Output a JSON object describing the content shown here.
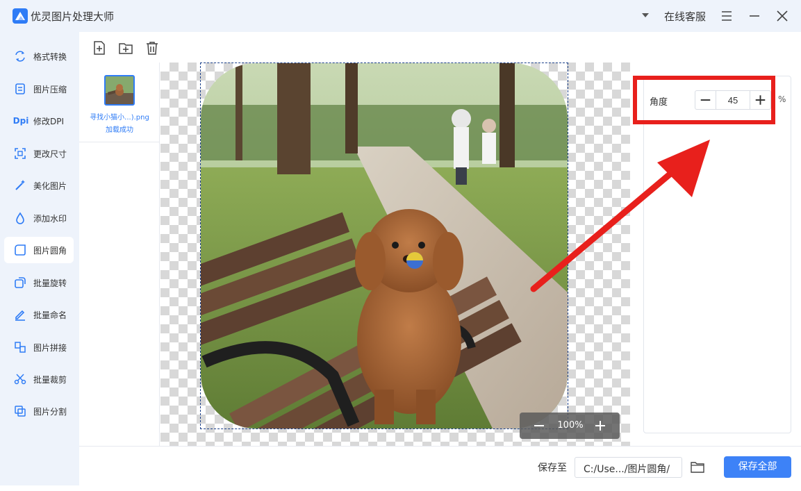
{
  "app": {
    "title": "优灵图片处理大师",
    "support_label": "在线客服"
  },
  "sidebar": {
    "items": [
      {
        "label": "格式转换",
        "icon": "format-convert-icon",
        "active": false
      },
      {
        "label": "图片压缩",
        "icon": "compress-icon",
        "active": false
      },
      {
        "label": "修改DPI",
        "icon": "dpi-icon",
        "icon_text": "Dpi",
        "active": false
      },
      {
        "label": "更改尺寸",
        "icon": "resize-icon",
        "active": false
      },
      {
        "label": "美化图片",
        "icon": "magic-wand-icon",
        "active": false
      },
      {
        "label": "添加水印",
        "icon": "watermark-icon",
        "active": false
      },
      {
        "label": "图片圆角",
        "icon": "rounded-corner-icon",
        "active": true
      },
      {
        "label": "批量旋转",
        "icon": "rotate-icon",
        "active": false
      },
      {
        "label": "批量命名",
        "icon": "rename-icon",
        "active": false
      },
      {
        "label": "图片拼接",
        "icon": "stitch-icon",
        "active": false
      },
      {
        "label": "批量裁剪",
        "icon": "scissors-icon",
        "active": false
      },
      {
        "label": "图片分割",
        "icon": "split-icon",
        "active": false
      }
    ]
  },
  "toolbar": {
    "icons": [
      "add-file-icon",
      "add-folder-icon",
      "trash-icon"
    ]
  },
  "file": {
    "name": "寻找小猫小...).png",
    "status": "加载成功"
  },
  "canvas": {
    "zoom": "100%"
  },
  "settings": {
    "angle_label": "角度",
    "angle_value": "45",
    "angle_unit": "%"
  },
  "bottom": {
    "save_to_label": "保存至",
    "save_path": "C:/Use.../图片圆角/",
    "save_all_label": "保存全部"
  },
  "colors": {
    "accent": "#2f7cf6",
    "annotation": "#e8201c",
    "background": "#eef3fb"
  }
}
